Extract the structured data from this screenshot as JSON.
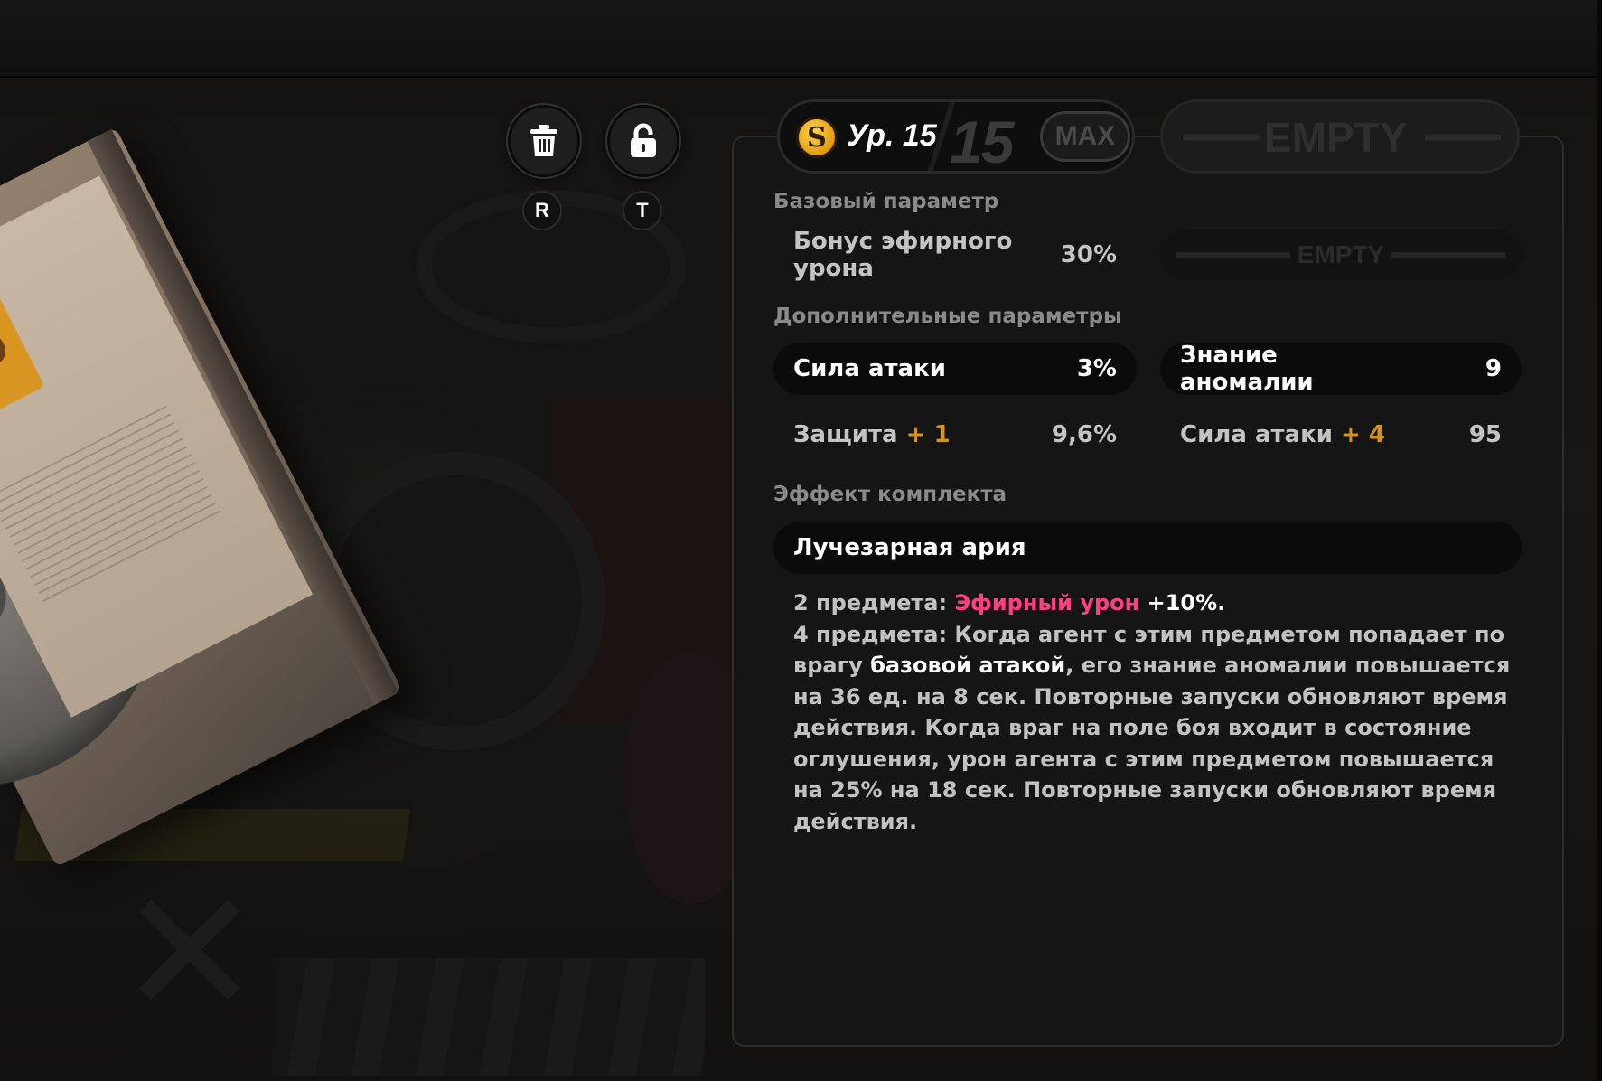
{
  "hotkeys": {
    "trash": "R",
    "lock": "T"
  },
  "level": {
    "badge_letter": "S",
    "label": "Ур. 15",
    "max_level": "15",
    "max_badge": "MAX"
  },
  "empty_slot": {
    "label": "EMPTY"
  },
  "base": {
    "title": "Базовый параметр",
    "stat": {
      "name": "Бонус эфирного урона",
      "value": "30%"
    },
    "empty_label": "EMPTY"
  },
  "extra": {
    "title": "Дополнительные параметры",
    "stats": [
      {
        "name": "Сила атаки",
        "plus": "",
        "value": "3%"
      },
      {
        "name": "Знание аномалии",
        "plus": "",
        "value": "9"
      },
      {
        "name": "Защита",
        "plus": "+ 1",
        "value": "9,6%"
      },
      {
        "name": "Сила атаки",
        "plus": "+ 4",
        "value": "95"
      }
    ]
  },
  "set": {
    "title": "Эффект комплекта",
    "name": "Лучезарная ария",
    "line1_prefix": "2 предмета:",
    "line1_highlight": "Эфирный урон",
    "line1_suffix": "+10%.",
    "line2_prefix": "4 предмета: Когда агент с этим предметом попадает по врагу",
    "line2_highlight": "базовой атакой",
    "line2_suffix": ", его знание аномалии повышается на 36 ед. на 8 сек. Повторные запуски обновляют время действия. Когда враг на поле боя входит в состояние оглушения, урон агента с этим предметом повышается на 25% на 18 сек. Повторные запуски обновляют время действия."
  },
  "disc": {
    "logo_letter": "S"
  },
  "colors": {
    "accent_pink": "#ff3f82",
    "accent_orange": "#d4921e",
    "level_gold": "#e39a10"
  }
}
